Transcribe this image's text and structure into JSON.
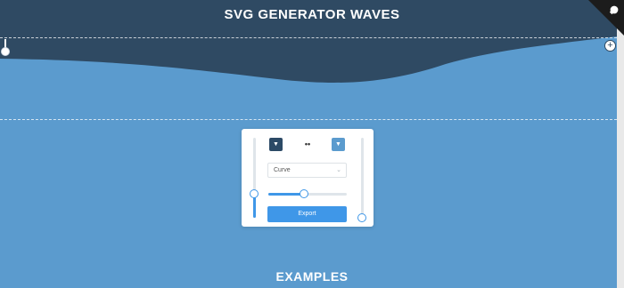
{
  "header": {
    "title": "SVG GENERATOR WAVES"
  },
  "colors": {
    "wave": "#2f4a63",
    "background": "#5b9bce",
    "accent": "#3f97e8"
  },
  "controls": {
    "color_left_icon": "chevron-down-icon",
    "color_right_icon": "chevron-down-icon",
    "swap_icon": "swap-icon",
    "curve_select": {
      "value": "Curve"
    },
    "amplitude_slider": {
      "value": 0.45
    },
    "left_vertical_slider": {
      "value": 0.3
    },
    "right_vertical_slider": {
      "value": 0.0
    },
    "export_label": "Export"
  },
  "add_point_symbol": "+",
  "sections": {
    "examples_title": "EXAMPLES"
  }
}
